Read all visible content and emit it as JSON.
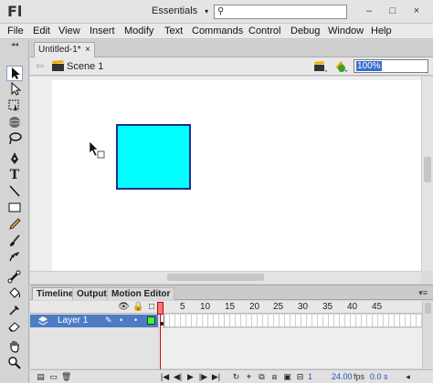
{
  "app": {
    "logo": "Fl"
  },
  "titlebar": {
    "workspace": "Essentials",
    "search_placeholder": "",
    "min": "–",
    "max": "□",
    "close": "×"
  },
  "menu": [
    "File",
    "Edit",
    "View",
    "Insert",
    "Modify",
    "Text",
    "Commands",
    "Control",
    "Debug",
    "Window",
    "Help"
  ],
  "tools": {
    "collapse": "◂◂",
    "items": [
      "selection-tool",
      "subselection-tool",
      "free-transform-tool",
      "3d-rotation-tool",
      "lasso-tool",
      "pen-tool",
      "text-tool",
      "line-tool",
      "rectangle-tool",
      "pencil-tool",
      "brush-tool",
      "deco-tool",
      "bone-tool",
      "paint-bucket-tool",
      "eyedropper-tool",
      "eraser-tool",
      "hand-tool",
      "zoom-tool"
    ]
  },
  "document": {
    "tab": "Untitled-1*",
    "close": "×",
    "scene": "Scene 1",
    "zoom": "100%"
  },
  "stage": {
    "fill_color": "#00ffff",
    "stroke_color": "#1b2e91"
  },
  "timeline": {
    "tabs": [
      "Timeline",
      "Output",
      "Motion Editor"
    ],
    "ruler": [
      "1",
      "5",
      "10",
      "15",
      "20",
      "25",
      "30",
      "35",
      "40",
      "45"
    ],
    "layer": {
      "name": "Layer 1",
      "color": "#33ff33"
    },
    "fps": "24.00",
    "fps_label": "fps",
    "time": "0.0 s",
    "frame": "1"
  }
}
